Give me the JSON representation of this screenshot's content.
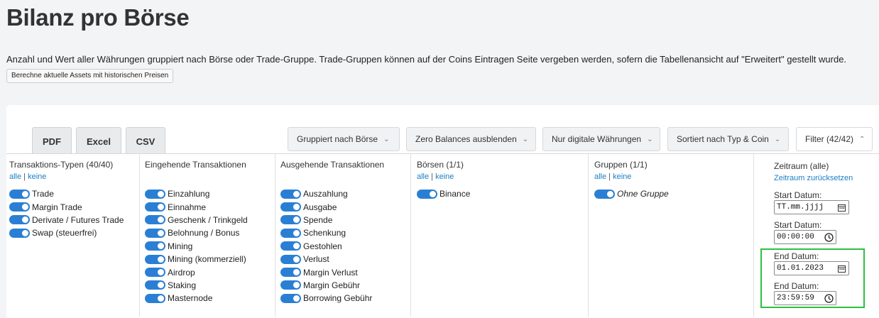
{
  "title": "Bilanz pro Börse",
  "description": "Anzahl und Wert aller Währungen gruppiert nach Börse oder Trade-Gruppe. Trade-Gruppen können auf der Coins Eintragen Seite vergeben werden, sofern die Tabellenansicht auf \"Erweitert\" gestellt wurde.",
  "calc_button": "Berechne aktuelle Assets mit historischen Preisen",
  "export_buttons": [
    "PDF",
    "Excel",
    "CSV"
  ],
  "dropdowns": {
    "group_by": "Gruppiert nach Börse",
    "zero_balances": "Zero Balances ausblenden",
    "currency": "Nur digitale Währungen",
    "sort": "Sortiert nach Typ & Coin",
    "filter": "Filter (42/42)"
  },
  "filters": {
    "all_label": "alle",
    "none_label": "keine",
    "transaction_types": {
      "header": "Transaktions-Typen (40/40)",
      "items": [
        "Trade",
        "Margin Trade",
        "Derivate / Futures Trade",
        "Swap (steuerfrei)"
      ]
    },
    "incoming": {
      "header": "Eingehende Transaktionen",
      "items": [
        "Einzahlung",
        "Einnahme",
        "Geschenk / Trinkgeld",
        "Belohnung / Bonus",
        "Mining",
        "Mining (kommerziell)",
        "Airdrop",
        "Staking",
        "Masternode"
      ]
    },
    "outgoing": {
      "header": "Ausgehende Transaktionen",
      "items": [
        "Auszahlung",
        "Ausgabe",
        "Spende",
        "Schenkung",
        "Gestohlen",
        "Verlust",
        "Margin Verlust",
        "Margin Gebühr",
        "Borrowing Gebühr"
      ]
    },
    "exchanges": {
      "header": "Börsen (1/1)",
      "items": [
        "Binance"
      ]
    },
    "groups": {
      "header": "Gruppen (1/1)",
      "items": [
        "Ohne Gruppe"
      ]
    },
    "period": {
      "header": "Zeitraum (alle)",
      "reset_link": "Zeitraum zurücksetzen",
      "start_date_label": "Start Datum:",
      "start_date_value": "TT.mm.jjjj",
      "start_time_label": "Start Datum:",
      "start_time_value": "00:00:00",
      "end_date_label": "End Datum:",
      "end_date_value": "01.01.2023",
      "end_time_label": "End Datum:",
      "end_time_value": "23:59:59"
    }
  },
  "colors": {
    "toggle": "#2a7fd4",
    "link": "#1a7ec6",
    "highlight": "#2fbf3f"
  }
}
